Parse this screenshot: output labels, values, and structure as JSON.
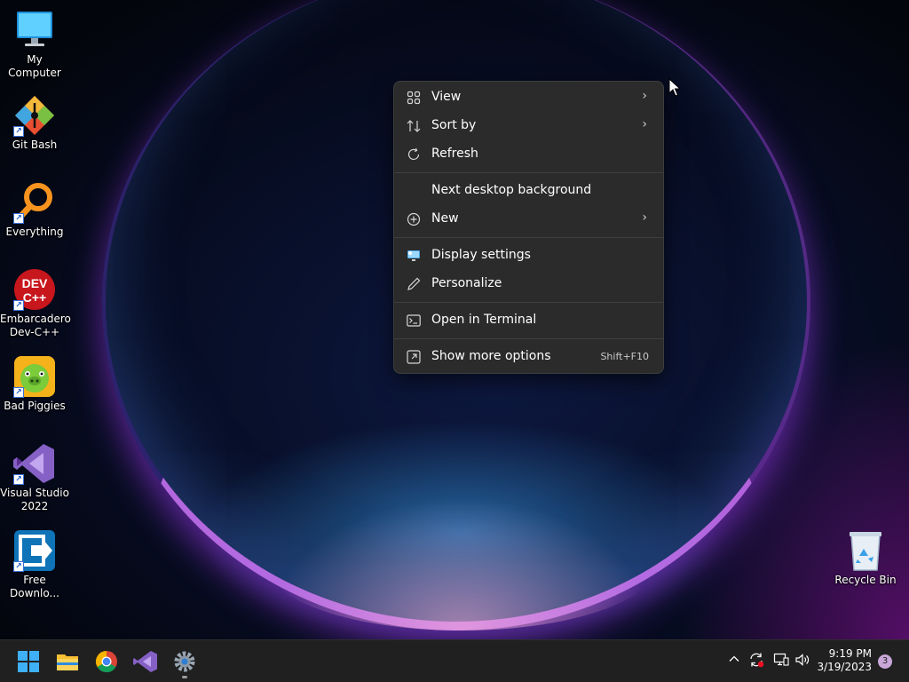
{
  "desktop": {
    "icons": [
      {
        "label": "My Computer",
        "icon": "monitor-icon"
      },
      {
        "label": "Git Bash",
        "icon": "git-icon"
      },
      {
        "label": "Everything",
        "icon": "magnifier-icon"
      },
      {
        "label": "Embarcadero Dev-C++",
        "icon": "devcpp-icon",
        "logo_text": "DEV C++"
      },
      {
        "label": "Bad Piggies",
        "icon": "pig-icon"
      },
      {
        "label": "Visual Studio 2022",
        "icon": "visual-studio-icon"
      },
      {
        "label": "Free Downlo...",
        "icon": "download-manager-icon"
      },
      {
        "label": "Recycle Bin",
        "icon": "recycle-bin-icon"
      }
    ]
  },
  "context_menu": {
    "items": [
      {
        "label": "View",
        "icon": "grid-icon",
        "submenu": true
      },
      {
        "label": "Sort by",
        "icon": "sort-icon",
        "submenu": true
      },
      {
        "label": "Refresh",
        "icon": "refresh-icon"
      },
      {
        "label": "Next desktop background",
        "icon": ""
      },
      {
        "label": "New",
        "icon": "plus-circle-icon",
        "submenu": true
      },
      {
        "label": "Display settings",
        "icon": "display-icon"
      },
      {
        "label": "Personalize",
        "icon": "pen-icon"
      },
      {
        "label": "Open in Terminal",
        "icon": "terminal-icon"
      },
      {
        "label": "Show more options",
        "icon": "more-options-icon",
        "shortcut": "Shift+F10"
      }
    ]
  },
  "taskbar": {
    "apps": [
      "start-icon",
      "file-explorer-icon",
      "chrome-icon",
      "visual-studio-icon",
      "settings-icon"
    ],
    "tray": [
      "chevron-up-icon",
      "sync-icon",
      "network-icon",
      "volume-icon"
    ],
    "time": "9:19 PM",
    "date": "3/19/2023",
    "notification_count": "3"
  },
  "colors": {
    "menu_bg": "#2b2b2b",
    "taskbar_bg": "#202020",
    "accent": "#4cc2ff"
  }
}
